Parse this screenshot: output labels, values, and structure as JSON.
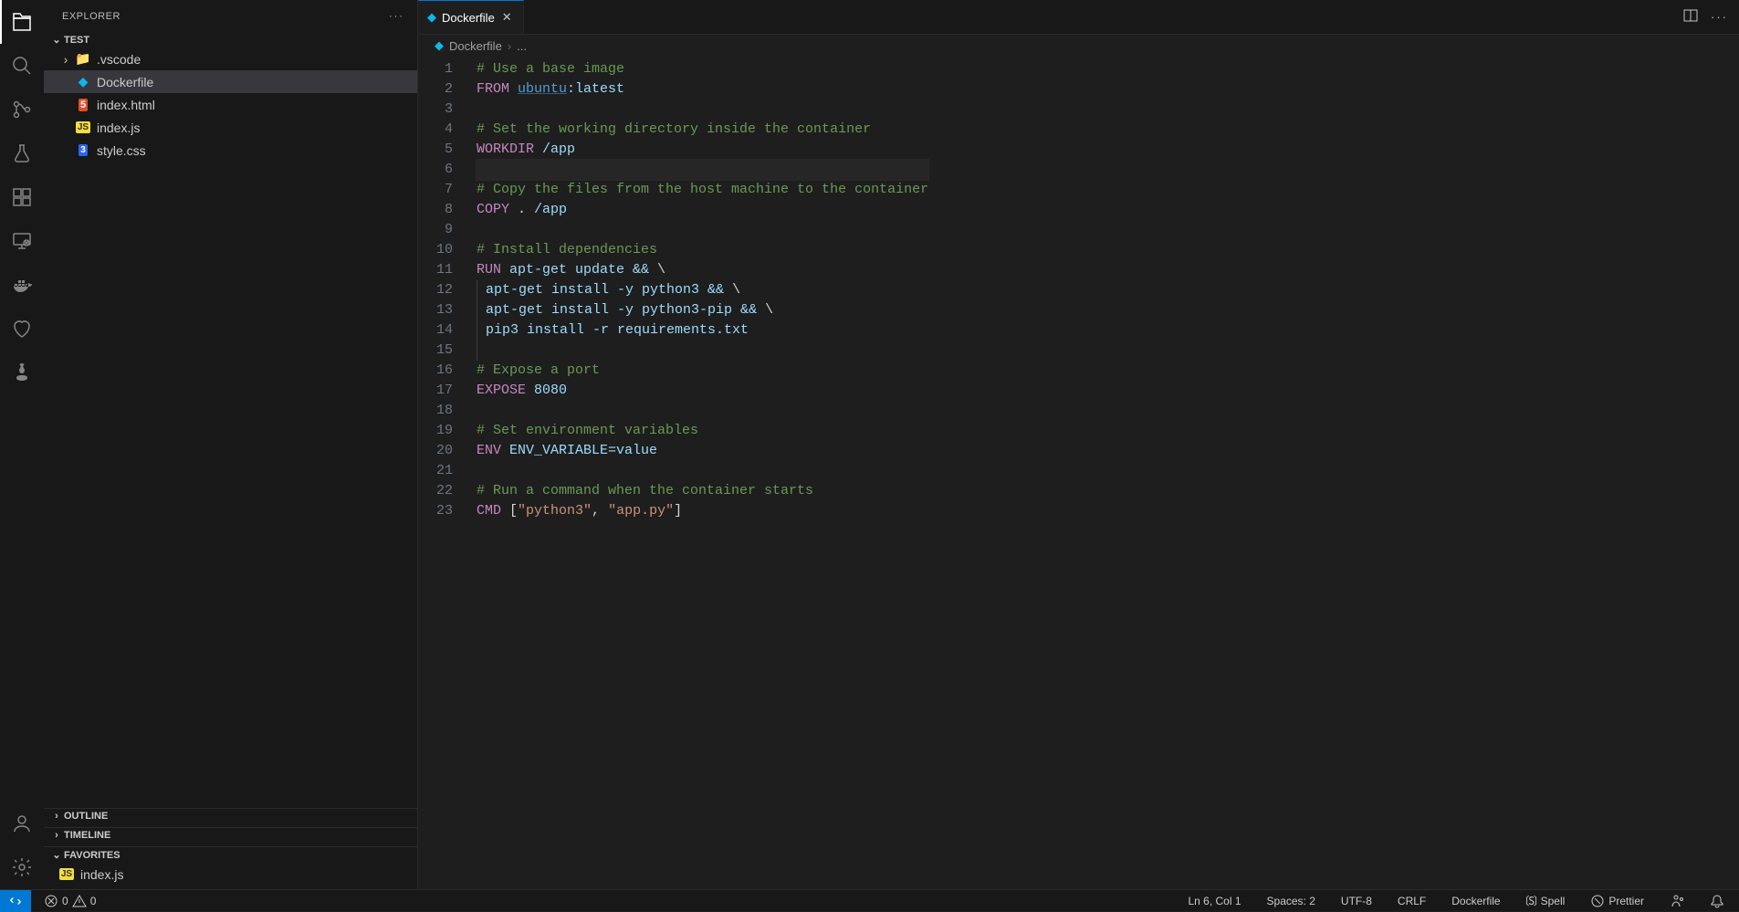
{
  "sidebar": {
    "title": "EXPLORER",
    "project": "TEST",
    "tree": [
      {
        "type": "folder",
        "label": ".vscode"
      },
      {
        "type": "file",
        "label": "Dockerfile",
        "icon": "docker",
        "active": true
      },
      {
        "type": "file",
        "label": "index.html",
        "icon": "html"
      },
      {
        "type": "file",
        "label": "index.js",
        "icon": "js"
      },
      {
        "type": "file",
        "label": "style.css",
        "icon": "css"
      }
    ],
    "sections": {
      "outline": "OUTLINE",
      "timeline": "TIMELINE",
      "favorites": "FAVORITES"
    },
    "favorites": [
      {
        "label": "index.js",
        "icon": "js"
      }
    ]
  },
  "tab": {
    "label": "Dockerfile"
  },
  "breadcrumb": {
    "file": "Dockerfile",
    "tail": "..."
  },
  "code_lines": [
    {
      "n": 1,
      "seg": [
        {
          "t": "# Use a base image",
          "c": "c-comment"
        }
      ]
    },
    {
      "n": 2,
      "seg": [
        {
          "t": "FROM",
          "c": "c-keyword"
        },
        {
          "t": " "
        },
        {
          "t": "ubuntu",
          "c": "c-special"
        },
        {
          "t": ":latest",
          "c": "c-var"
        }
      ]
    },
    {
      "n": 3,
      "seg": []
    },
    {
      "n": 4,
      "seg": [
        {
          "t": "# Set the working directory inside the container",
          "c": "c-comment"
        }
      ]
    },
    {
      "n": 5,
      "seg": [
        {
          "t": "WORKDIR",
          "c": "c-keyword"
        },
        {
          "t": " /app",
          "c": "c-var"
        }
      ]
    },
    {
      "n": 6,
      "seg": [],
      "current": true
    },
    {
      "n": 7,
      "seg": [
        {
          "t": "# Copy the files from the host machine to the container",
          "c": "c-comment"
        }
      ]
    },
    {
      "n": 8,
      "seg": [
        {
          "t": "COPY",
          "c": "c-keyword"
        },
        {
          "t": " . ",
          "c": "c-op"
        },
        {
          "t": "/app",
          "c": "c-var"
        }
      ]
    },
    {
      "n": 9,
      "seg": []
    },
    {
      "n": 10,
      "seg": [
        {
          "t": "# Install dependencies",
          "c": "c-comment"
        }
      ]
    },
    {
      "n": 11,
      "seg": [
        {
          "t": "RUN",
          "c": "c-keyword"
        },
        {
          "t": " apt-get update && ",
          "c": "c-var"
        },
        {
          "t": "\\",
          "c": "c-op"
        }
      ]
    },
    {
      "n": 12,
      "indent": true,
      "seg": [
        {
          "t": "apt-get install -y python3 && ",
          "c": "c-var"
        },
        {
          "t": "\\",
          "c": "c-op"
        }
      ]
    },
    {
      "n": 13,
      "indent": true,
      "seg": [
        {
          "t": "apt-get install -y python3-pip && ",
          "c": "c-var"
        },
        {
          "t": "\\",
          "c": "c-op"
        }
      ]
    },
    {
      "n": 14,
      "indent": true,
      "seg": [
        {
          "t": "pip3 install -r requirements.txt",
          "c": "c-var"
        }
      ]
    },
    {
      "n": 15,
      "indent": true,
      "seg": []
    },
    {
      "n": 16,
      "seg": [
        {
          "t": "# Expose a port",
          "c": "c-comment"
        }
      ]
    },
    {
      "n": 17,
      "seg": [
        {
          "t": "EXPOSE",
          "c": "c-keyword"
        },
        {
          "t": " 8080",
          "c": "c-var"
        }
      ]
    },
    {
      "n": 18,
      "seg": []
    },
    {
      "n": 19,
      "seg": [
        {
          "t": "# Set environment variables",
          "c": "c-comment"
        }
      ]
    },
    {
      "n": 20,
      "seg": [
        {
          "t": "ENV",
          "c": "c-keyword"
        },
        {
          "t": " ENV_VARIABLE=value",
          "c": "c-var"
        }
      ]
    },
    {
      "n": 21,
      "seg": []
    },
    {
      "n": 22,
      "seg": [
        {
          "t": "# Run a command when the container starts",
          "c": "c-comment"
        }
      ]
    },
    {
      "n": 23,
      "seg": [
        {
          "t": "CMD",
          "c": "c-keyword"
        },
        {
          "t": " [",
          "c": "c-op"
        },
        {
          "t": "\"python3\"",
          "c": "c-string"
        },
        {
          "t": ", ",
          "c": "c-op"
        },
        {
          "t": "\"app.py\"",
          "c": "c-string"
        },
        {
          "t": "]",
          "c": "c-op"
        }
      ]
    }
  ],
  "status": {
    "errors": "0",
    "warnings": "0",
    "cursor": "Ln 6, Col 1",
    "spaces": "Spaces: 2",
    "encoding": "UTF-8",
    "eol": "CRLF",
    "lang": "Dockerfile",
    "spell": "Spell",
    "prettier": "Prettier"
  }
}
